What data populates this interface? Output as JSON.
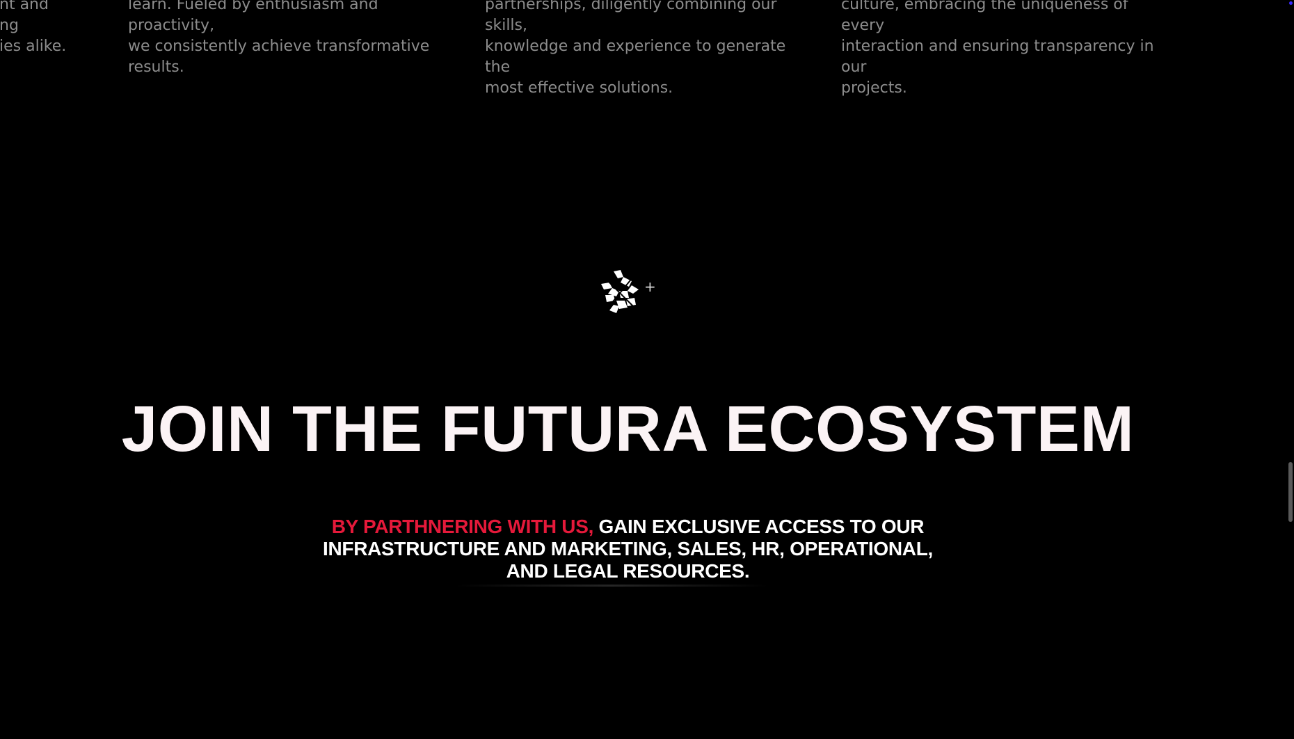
{
  "features": {
    "columns": [
      {
        "text": "nt and\nng\nies alike."
      },
      {
        "text": "learn. Fueled by enthusiasm and proactivity,\nwe consistently achieve transformative\nresults."
      },
      {
        "text": "partnerships, diligently combining our skills,\nknowledge and experience to generate the\nmost effective solutions."
      },
      {
        "text": "culture, embracing the uniqueness of every\ninteraction and ensuring transparency in our\nprojects."
      }
    ]
  },
  "hero": {
    "logo_icon": "futura-logo-icon",
    "plus_glyph": "+",
    "headline": "JOIN THE FUTURA ECOSYSTEM",
    "subline_accent": "BY PARTHNERING WITH US,",
    "subline_rest": " GAIN EXCLUSIVE ACCESS TO OUR INFRASTRUCTURE AND MARKETING, SALES, HR, OPERATIONAL, AND LEGAL RESOURCES."
  },
  "colors": {
    "background": "#000000",
    "accent": "#e5193a",
    "body_text": "#8c8c8c",
    "headline": "#fbf3f5"
  }
}
